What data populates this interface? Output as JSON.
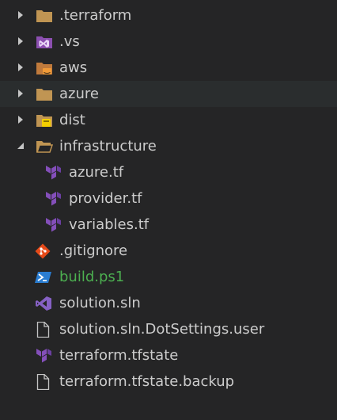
{
  "explorer": {
    "items": [
      {
        "label": ".terraform",
        "kind": "folder",
        "icon": "folder-icon",
        "twisty": "collapsed"
      },
      {
        "label": ".vs",
        "kind": "folder",
        "icon": "visual-studio-folder-icon",
        "twisty": "collapsed"
      },
      {
        "label": "aws",
        "kind": "folder",
        "icon": "aws-folder-icon",
        "twisty": "collapsed"
      },
      {
        "label": "azure",
        "kind": "folder",
        "icon": "folder-icon",
        "twisty": "collapsed",
        "hover": true
      },
      {
        "label": "dist",
        "kind": "folder",
        "icon": "dist-folder-icon",
        "twisty": "collapsed"
      },
      {
        "label": "infrastructure",
        "kind": "folder",
        "icon": "folder-open-icon",
        "twisty": "expanded"
      },
      {
        "label": "azure.tf",
        "kind": "file",
        "icon": "terraform-icon",
        "depth": 1
      },
      {
        "label": "provider.tf",
        "kind": "file",
        "icon": "terraform-icon",
        "depth": 1
      },
      {
        "label": "variables.tf",
        "kind": "file",
        "icon": "terraform-icon",
        "depth": 1
      },
      {
        "label": ".gitignore",
        "kind": "file",
        "icon": "git-icon"
      },
      {
        "label": "build.ps1",
        "kind": "file",
        "icon": "powershell-icon",
        "status": "untracked"
      },
      {
        "label": "solution.sln",
        "kind": "file",
        "icon": "visual-studio-icon"
      },
      {
        "label": "solution.sln.DotSettings.user",
        "kind": "file",
        "icon": "file-icon"
      },
      {
        "label": "terraform.tfstate",
        "kind": "file",
        "icon": "terraform-icon"
      },
      {
        "label": "terraform.tfstate.backup",
        "kind": "file",
        "icon": "file-icon"
      }
    ]
  },
  "colors": {
    "background": "#252526",
    "hover_row": "#2a2d2e",
    "text": "#cccccc",
    "untracked_text": "#4caf50",
    "folder": "#c09553",
    "terraform": "#844fba",
    "visual_studio": "#8661c5",
    "git": "#e64a19",
    "powershell": "#2a7dd1"
  }
}
